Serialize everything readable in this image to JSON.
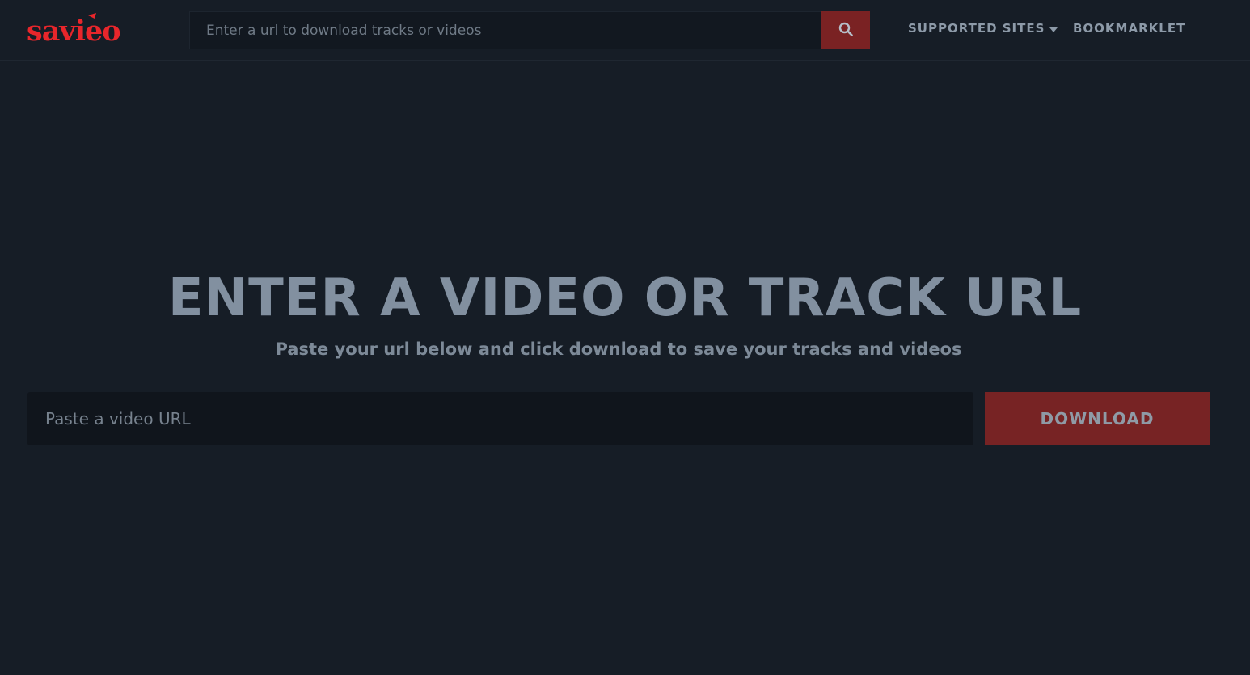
{
  "brand": {
    "logo_text": "savieo",
    "logo_color": "#e8262b"
  },
  "header": {
    "search": {
      "placeholder": "Enter a url to download tracks or videos",
      "button_icon": "search-icon"
    },
    "nav": {
      "supported_sites": "SUPPORTED SITES",
      "supported_sites_icon": "caret-down-icon",
      "bookmarklet": "BOOKMARKLET"
    }
  },
  "hero": {
    "title": "ENTER A VIDEO OR TRACK URL",
    "subtitle": "Paste your url below and click download to save your tracks and videos",
    "input_placeholder": "Paste a video URL",
    "download_label": "DOWNLOAD"
  },
  "colors": {
    "background": "#161d26",
    "accent": "#7a2223",
    "text_muted": "#8d9aa8"
  }
}
